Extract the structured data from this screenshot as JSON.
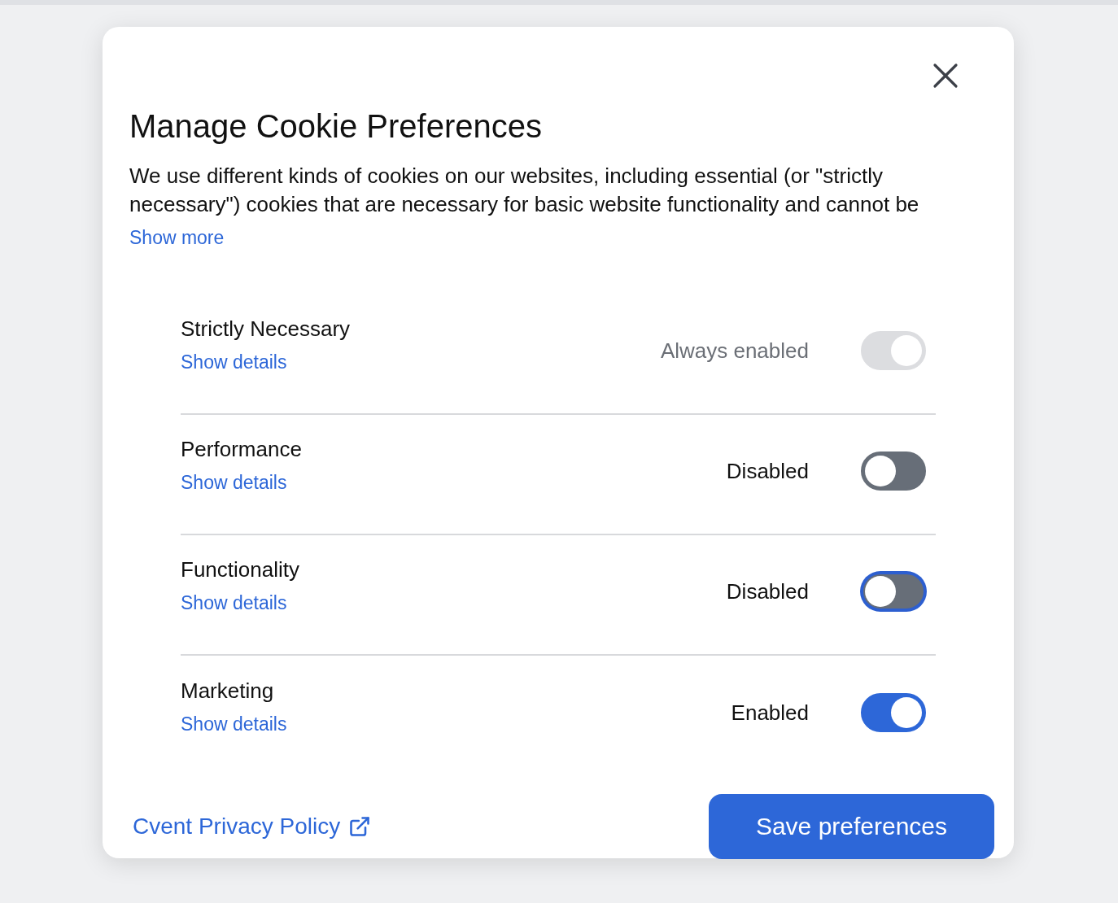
{
  "dialog": {
    "title": "Manage Cookie Preferences",
    "description": "We use different kinds of cookies on our websites, including essential (or \"strictly necessary\") cookies that are necessary for basic website functionality and cannot be",
    "show_more": "Show more"
  },
  "categories": [
    {
      "name": "Strictly Necessary",
      "details_link": "Show details",
      "status": "Always enabled",
      "on": true,
      "disabled": true,
      "focused": false
    },
    {
      "name": "Performance",
      "details_link": "Show details",
      "status": "Disabled",
      "on": false,
      "disabled": false,
      "focused": false
    },
    {
      "name": "Functionality",
      "details_link": "Show details",
      "status": "Disabled",
      "on": false,
      "disabled": false,
      "focused": true
    },
    {
      "name": "Marketing",
      "details_link": "Show details",
      "status": "Enabled",
      "on": true,
      "disabled": false,
      "focused": false
    }
  ],
  "footer": {
    "privacy_link": "Cvent Privacy Policy",
    "save_button": "Save preferences"
  }
}
